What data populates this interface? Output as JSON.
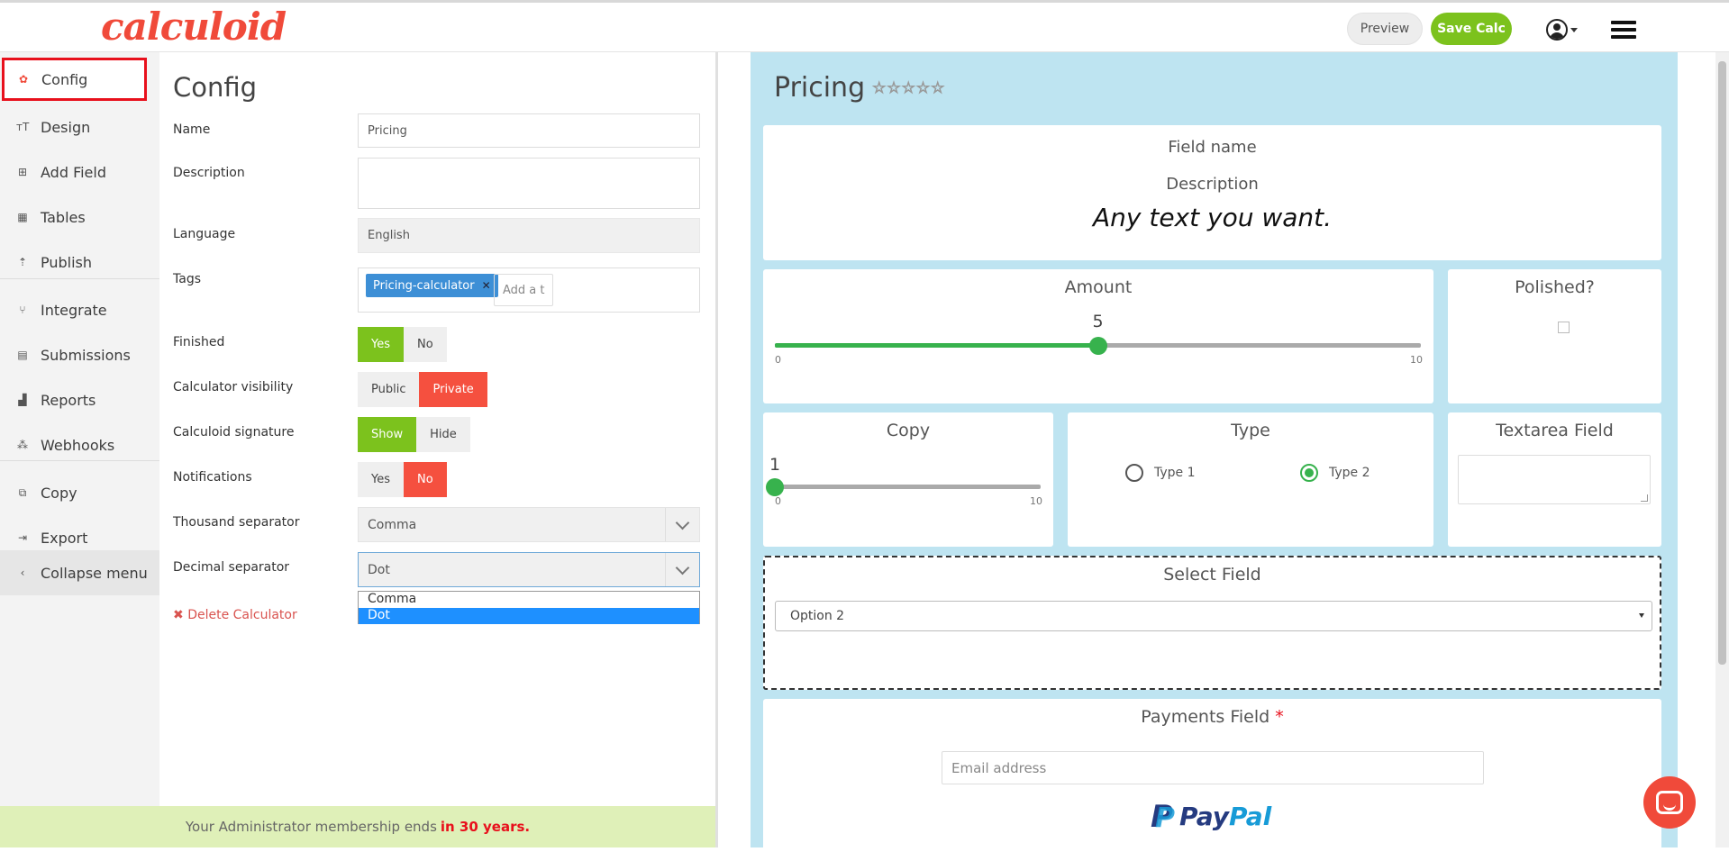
{
  "app": {
    "logo": "calculoid",
    "preview_label": "Preview",
    "save_label": "Save Calc"
  },
  "sidebar": {
    "items": [
      {
        "label": "Config",
        "icon": "gear-icon"
      },
      {
        "label": "Design",
        "icon": "text-icon"
      },
      {
        "label": "Add Field",
        "icon": "plus-square-icon"
      },
      {
        "label": "Tables",
        "icon": "table-icon"
      },
      {
        "label": "Publish",
        "icon": "upload-icon"
      },
      {
        "label": "Integrate",
        "icon": "integrate-icon"
      },
      {
        "label": "Submissions",
        "icon": "inbox-icon"
      },
      {
        "label": "Reports",
        "icon": "bar-chart-icon"
      },
      {
        "label": "Webhooks",
        "icon": "webhook-icon"
      },
      {
        "label": "Copy",
        "icon": "copy-icon"
      },
      {
        "label": "Export",
        "icon": "export-icon"
      },
      {
        "label": "Collapse menu",
        "icon": "chevron-left-icon"
      }
    ]
  },
  "config": {
    "title": "Config",
    "name_label": "Name",
    "name_value": "Pricing",
    "description_label": "Description",
    "description_value": "",
    "language_label": "Language",
    "language_value": "English",
    "tags_label": "Tags",
    "tag": "Pricing-calculator",
    "tag_placeholder": "Add a t",
    "finished_label": "Finished",
    "finished_yes": "Yes",
    "finished_no": "No",
    "visibility_label": "Calculator visibility",
    "visibility_public": "Public",
    "visibility_private": "Private",
    "signature_label": "Calculoid signature",
    "signature_show": "Show",
    "signature_hide": "Hide",
    "notifications_label": "Notifications",
    "notifications_yes": "Yes",
    "notifications_no": "No",
    "thousand_label": "Thousand separator",
    "thousand_value": "Comma",
    "decimal_label": "Decimal separator",
    "decimal_value": "Dot",
    "decimal_options": [
      "Comma",
      "Dot"
    ],
    "delete_label": "Delete Calculator",
    "membership_text": "Your Administrator membership ends",
    "membership_highlight": "in 30 years."
  },
  "preview": {
    "title": "Pricing",
    "stars": "☆☆☆☆☆",
    "field_name": "Field name",
    "description": "Description",
    "any_text": "Any text you want.",
    "amount_label": "Amount",
    "amount_value": "5",
    "amount_min": "0",
    "amount_max": "10",
    "amount_fraction": 0.5,
    "polished_label": "Polished?",
    "copy_label": "Copy",
    "copy_value": "1",
    "copy_min": "0",
    "copy_max": "10",
    "copy_fraction": 0.0,
    "type_label": "Type",
    "type_option1": "Type 1",
    "type_option2": "Type 2",
    "textarea_label": "Textarea Field",
    "select_label": "Select Field",
    "select_value": "Option 2",
    "payments_label": "Payments Field",
    "payments_required": "*",
    "email_placeholder": "Email address",
    "paypal_pay": "Pay",
    "paypal_pal": "Pal"
  },
  "colors": {
    "accent_red": "#f04a3a",
    "green": "#7cc21d",
    "preview_bg": "#bee4f1"
  }
}
